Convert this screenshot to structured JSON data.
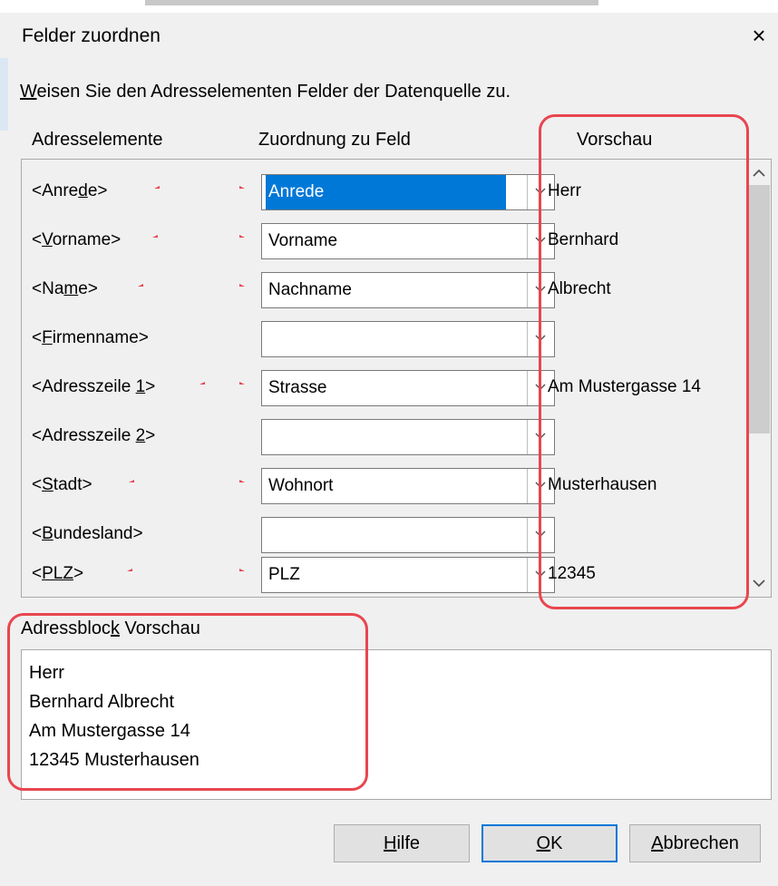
{
  "dialog": {
    "title": "Felder zuordnen",
    "close_label": "×",
    "instruction": {
      "prefix": "W",
      "rest": "eisen Sie den Adresselementen Felder der Datenquelle zu."
    }
  },
  "columns": {
    "elements": "Adresselemente",
    "mapping": "Zuordnung zu Feld",
    "preview": "Vorschau"
  },
  "rows": [
    {
      "label": {
        "pre": "<Anre",
        "acc": "d",
        "post": "e>"
      },
      "field": "Anrede",
      "preview": "Herr",
      "selected": true
    },
    {
      "label": {
        "pre": "<",
        "acc": "V",
        "post": "orname>"
      },
      "field": "Vorname",
      "preview": "Bernhard"
    },
    {
      "label": {
        "pre": "<Na",
        "acc": "m",
        "post": "e>"
      },
      "field": "Nachname",
      "preview": "Albrecht"
    },
    {
      "label": {
        "pre": "<",
        "acc": "F",
        "post": "irmenname>"
      },
      "field": "",
      "preview": ""
    },
    {
      "label": {
        "pre": "<Adresszeile ",
        "acc": "1",
        "post": ">"
      },
      "field": "Strasse",
      "preview": "Am Mustergasse 14"
    },
    {
      "label": {
        "pre": "<Adresszeile ",
        "acc": "2",
        "post": ">"
      },
      "field": "",
      "preview": ""
    },
    {
      "label": {
        "pre": "<",
        "acc": "S",
        "post": "tadt>"
      },
      "field": "Wohnort",
      "preview": "Musterhausen"
    },
    {
      "label": {
        "pre": "<",
        "acc": "B",
        "post": "undesland>"
      },
      "field": "",
      "preview": ""
    },
    {
      "label": {
        "pre": "<",
        "acc": "PLZ",
        "post": ">"
      },
      "field": "PLZ",
      "preview": "12345"
    }
  ],
  "address_block": {
    "label": {
      "pre": "Adressbloc",
      "acc": "k",
      "post": " Vorschau"
    },
    "lines": [
      "Herr",
      "Bernhard Albrecht",
      "Am Mustergasse 14",
      "12345 Musterhausen"
    ]
  },
  "buttons": {
    "help": {
      "acc": "H",
      "post": "ilfe"
    },
    "ok": {
      "acc": "O",
      "post": "K"
    },
    "cancel": {
      "acc": "A",
      "post": "bbrechen"
    }
  },
  "colors": {
    "highlight": "#e8464f",
    "selection": "#0078d7"
  },
  "icons": [
    "close-icon",
    "chevron-down-icon",
    "scroll-up-icon",
    "scroll-down-icon",
    "double-arrow-icon"
  ]
}
